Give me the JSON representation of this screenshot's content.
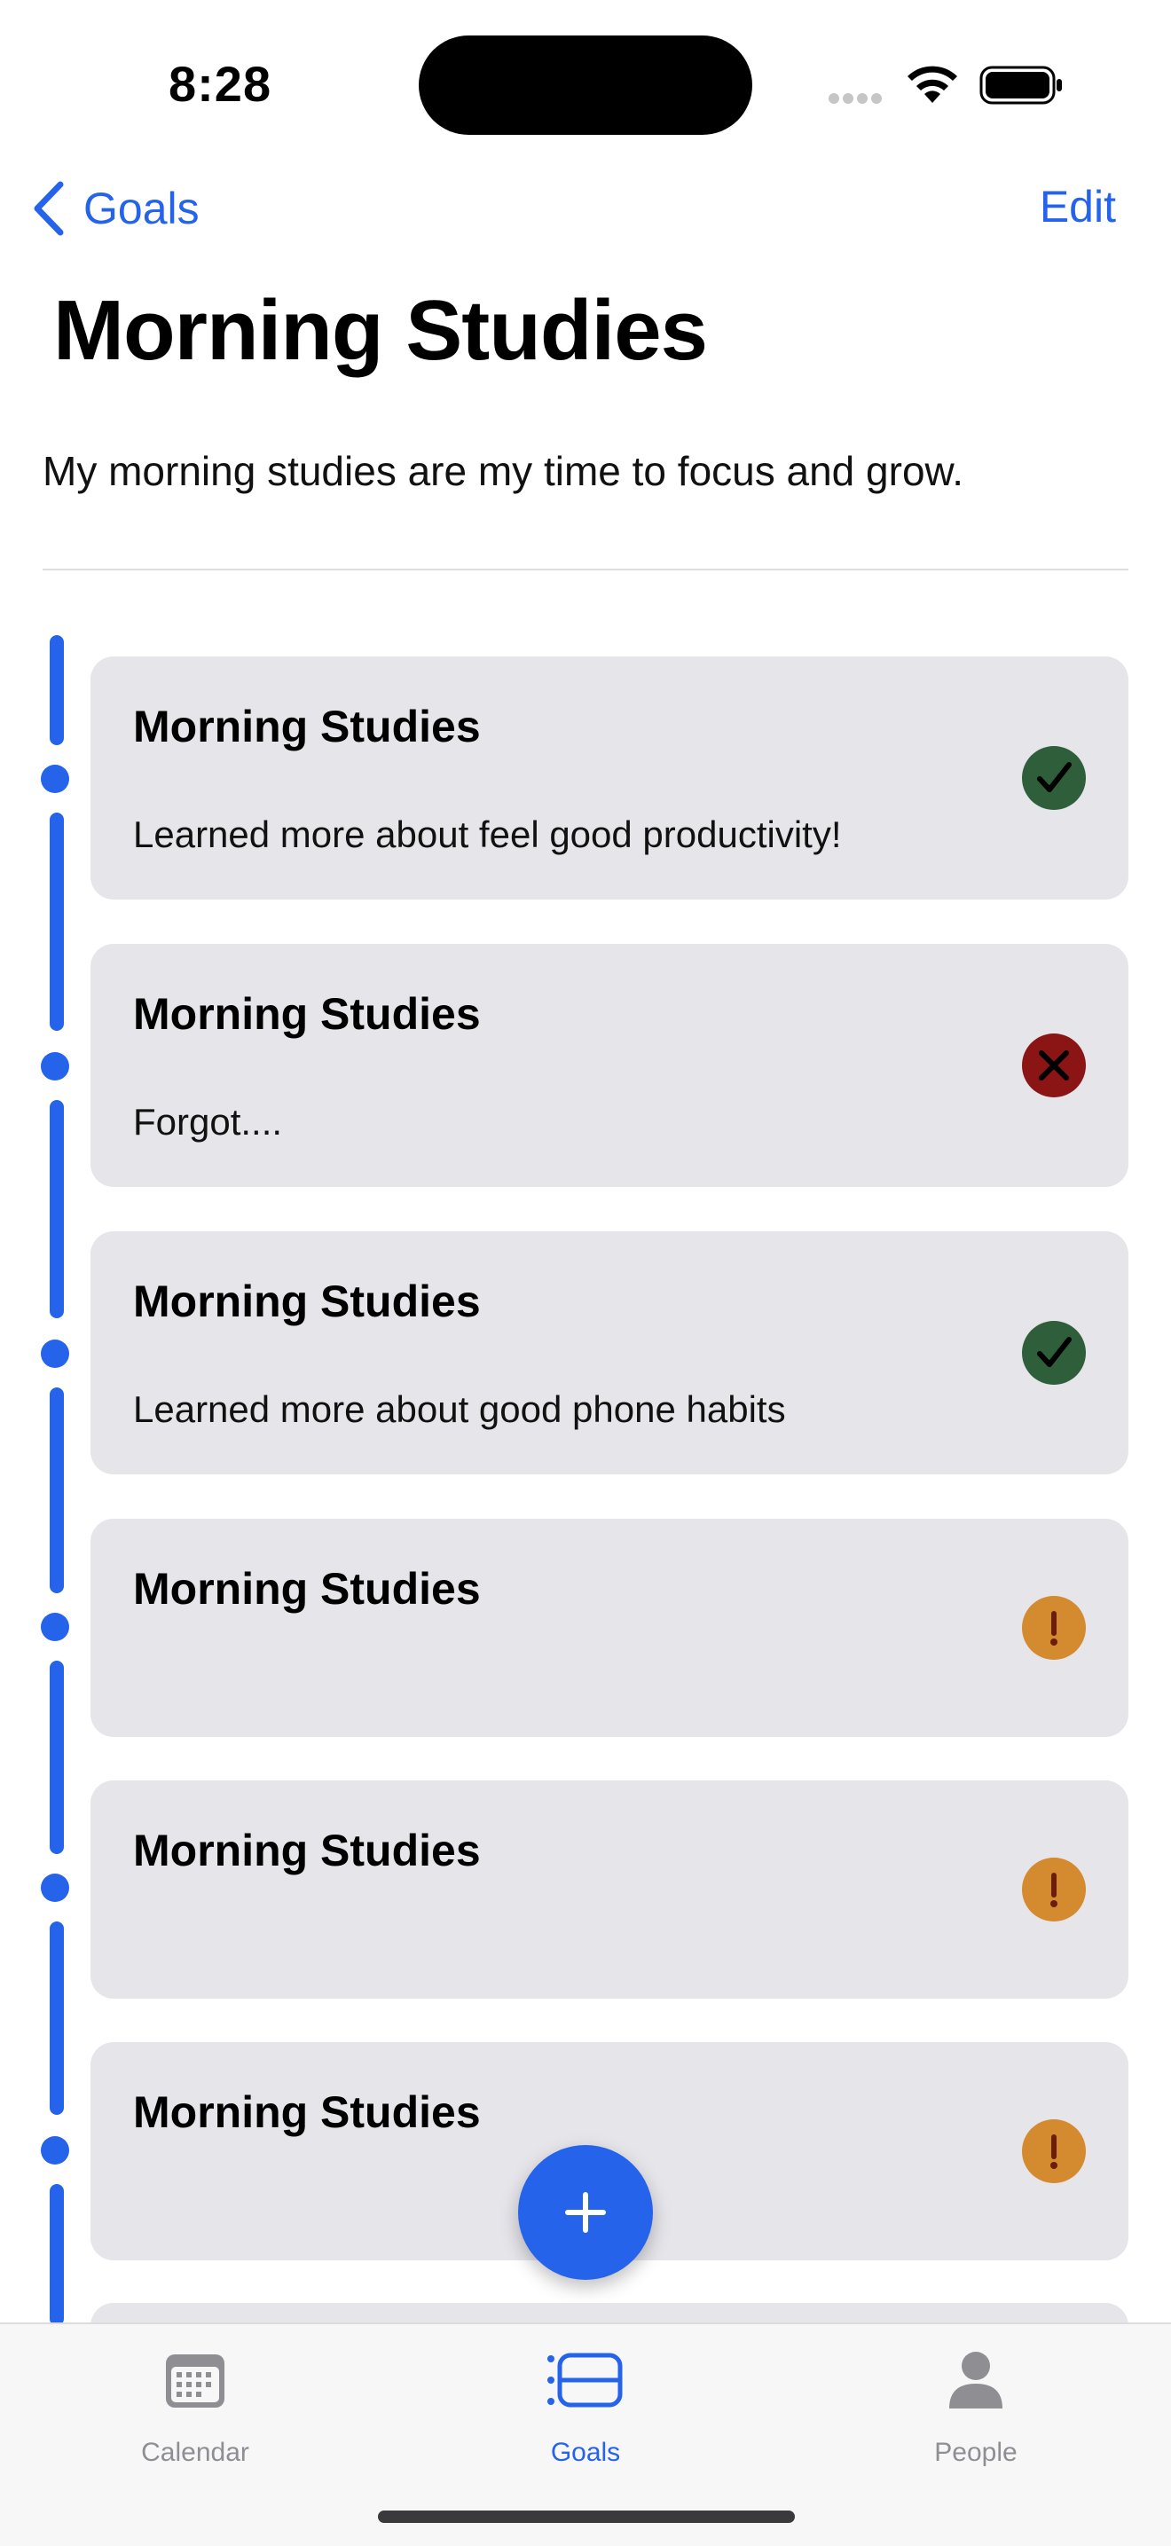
{
  "status_bar": {
    "time": "8:28"
  },
  "nav": {
    "back_label": "Goals",
    "edit_label": "Edit"
  },
  "page": {
    "title": "Morning Studies",
    "description": "My morning studies are my time to focus and grow."
  },
  "entries": [
    {
      "title": "Morning Studies",
      "note": "Learned more about feel good productivity!",
      "status": "success",
      "status_icon": "checkmark-icon"
    },
    {
      "title": "Morning Studies",
      "note": "Forgot....",
      "status": "failed",
      "status_icon": "x-mark-icon"
    },
    {
      "title": "Morning Studies",
      "note": "Learned more about good phone habits",
      "status": "success",
      "status_icon": "checkmark-icon"
    },
    {
      "title": "Morning Studies",
      "note": "",
      "status": "pending",
      "status_icon": "exclamation-icon"
    },
    {
      "title": "Morning Studies",
      "note": "",
      "status": "pending",
      "status_icon": "exclamation-icon"
    },
    {
      "title": "Morning Studies",
      "note": "",
      "status": "pending",
      "status_icon": "exclamation-icon"
    }
  ],
  "tab_bar": {
    "tabs": [
      {
        "label": "Calendar",
        "icon": "calendar-icon",
        "active": false
      },
      {
        "label": "Goals",
        "icon": "goals-icon",
        "active": true
      },
      {
        "label": "People",
        "icon": "person-icon",
        "active": false
      }
    ]
  },
  "colors": {
    "accent": "#2563eb",
    "success": "#2e5e3a",
    "failed": "#8b1515",
    "pending": "#d48a2e",
    "card_background": "#e5e5ea"
  }
}
